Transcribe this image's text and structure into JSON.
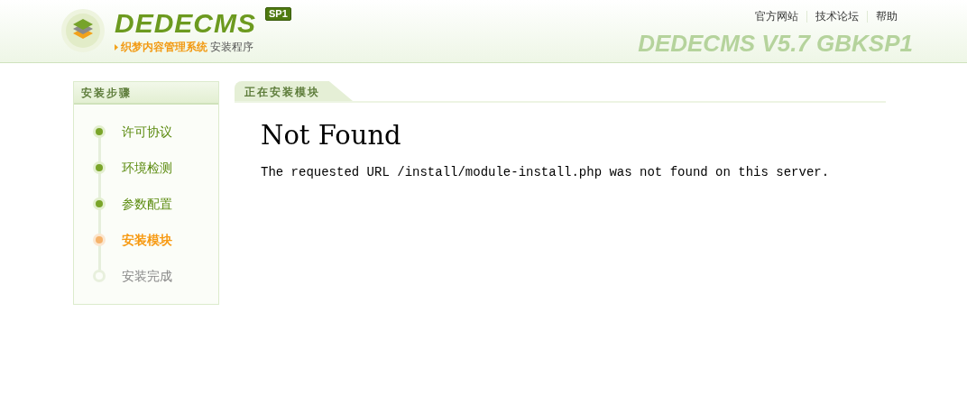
{
  "header": {
    "logo_text": "DEDECMS",
    "badge": "SP1",
    "tagline": "织梦内容管理系统",
    "subtitle": "安装程序",
    "version": "DEDECMS V5.7 GBKSP1",
    "links": [
      "官方网站",
      "技术论坛",
      "帮助"
    ]
  },
  "sidebar": {
    "title": "安装步骤",
    "steps": [
      {
        "label": "许可协议",
        "kind": "done"
      },
      {
        "label": "环境检测",
        "kind": "done"
      },
      {
        "label": "参数配置",
        "kind": "done"
      },
      {
        "label": "安装模块",
        "kind": "current"
      },
      {
        "label": "安装完成",
        "kind": "pending"
      }
    ]
  },
  "main": {
    "title": "正在安装模块",
    "heading": "Not Found",
    "message": "The requested URL /install/module-install.php was not found on this server."
  }
}
